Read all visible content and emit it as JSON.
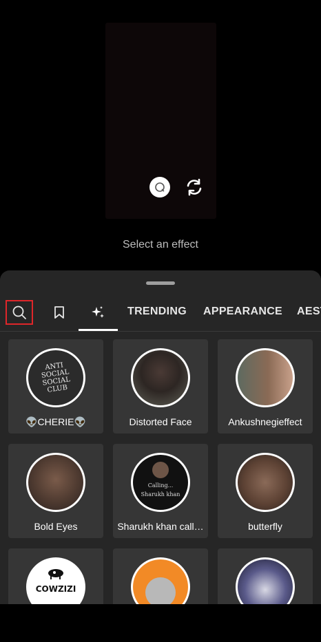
{
  "hint_text": "Select an effect",
  "tabs": {
    "trending": "TRENDING",
    "appearance": "APPEARANCE",
    "aesthetics_partial": "AEST"
  },
  "effects": [
    {
      "label": "👽CHERIE👽",
      "thumb_text": "ANTI SOCIAL SOCIAL CLUB"
    },
    {
      "label": "Distorted Face"
    },
    {
      "label": "Ankushnegieffect"
    },
    {
      "label": "Bold Eyes"
    },
    {
      "label": "Sharukh khan call…",
      "thumb_text_1": "Calling...",
      "thumb_text_2": "Sharukh khan"
    },
    {
      "label": "butterfly"
    },
    {
      "label": "",
      "thumb_text": "COWZIZI"
    },
    {
      "label": ""
    },
    {
      "label": ""
    }
  ],
  "colors": {
    "sheet_bg": "#262626",
    "card_bg": "#363636",
    "highlight": "#e0262a"
  }
}
